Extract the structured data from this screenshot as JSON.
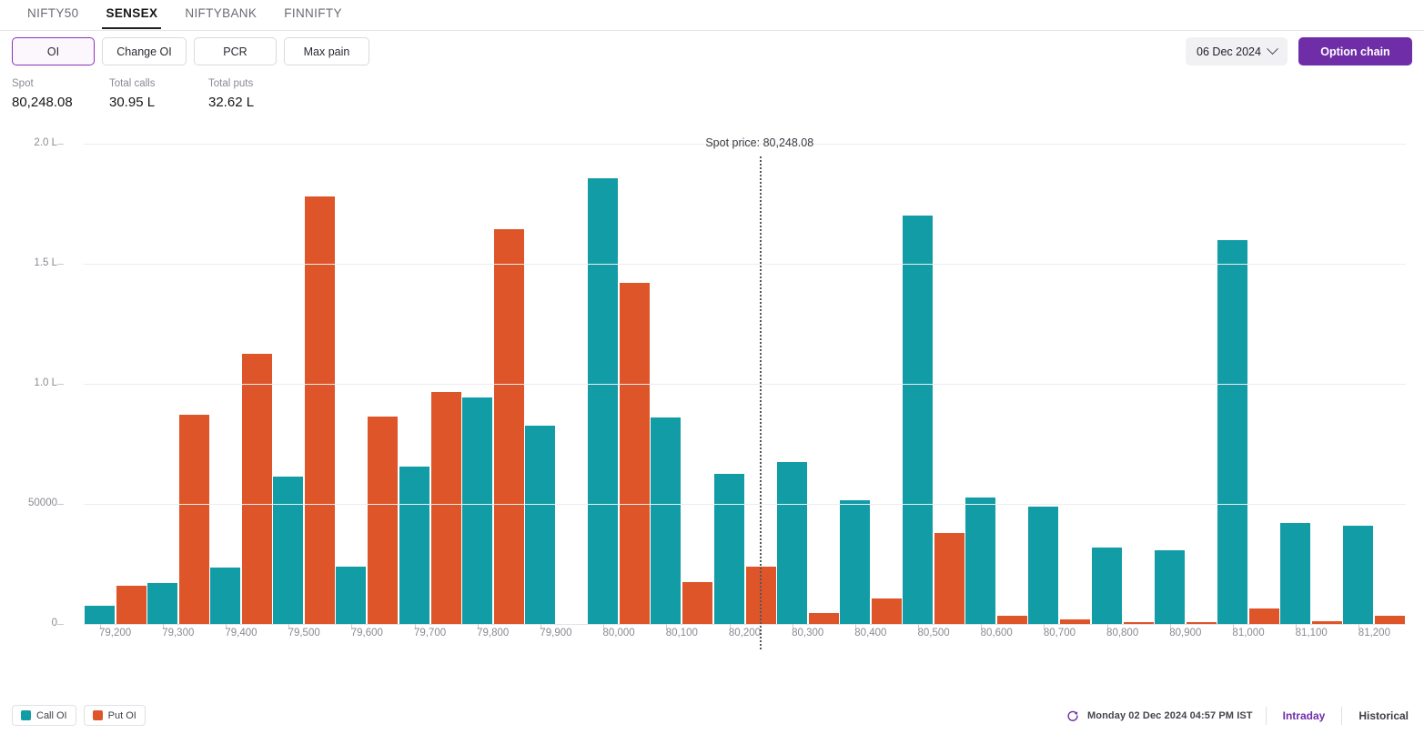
{
  "tabs": [
    {
      "label": "NIFTY50",
      "active": false
    },
    {
      "label": "SENSEX",
      "active": true
    },
    {
      "label": "NIFTYBANK",
      "active": false
    },
    {
      "label": "FINNIFTY",
      "active": false
    }
  ],
  "toolbar": {
    "oi_label": "OI",
    "change_oi_label": "Change OI",
    "pcr_label": "PCR",
    "max_pain_label": "Max pain",
    "expiry_date": "06 Dec 2024",
    "option_chain_label": "Option chain"
  },
  "stats": {
    "spot_label": "Spot",
    "spot_value": "80,248.08",
    "total_calls_label": "Total calls",
    "total_calls_value": "30.95 L",
    "total_puts_label": "Total puts",
    "total_puts_value": "32.62 L"
  },
  "footer": {
    "legend": [
      {
        "label": "Call OI",
        "color": "#119ca6"
      },
      {
        "label": "Put OI",
        "color": "#dd5529"
      }
    ],
    "timestamp": "Monday 02 Dec 2024 04:57 PM IST",
    "intraday_label": "Intraday",
    "historical_label": "Historical"
  },
  "chart_data": {
    "type": "bar",
    "title": "",
    "xlabel": "",
    "ylabel": "",
    "ylim": [
      0,
      200000
    ],
    "grid": true,
    "legend_position": "bottom-left",
    "ytick_values": [
      0,
      50000,
      100000,
      150000,
      200000
    ],
    "ytick_labels": [
      "0",
      "50000",
      "1.0 L",
      "1.5 L",
      "2.0 L"
    ],
    "annotation": {
      "label": "Spot price: 80,248.08",
      "x_value": 80248.08
    },
    "colors": {
      "call": "#119ca6",
      "put": "#dd5529"
    },
    "categories": [
      "79,200",
      "79,300",
      "79,400",
      "79,500",
      "79,600",
      "79,700",
      "79,800",
      "79,900",
      "80,000",
      "80,100",
      "80,200",
      "80,300",
      "80,400",
      "80,500",
      "80,600",
      "80,700",
      "80,800",
      "80,900",
      "81,000",
      "81,100",
      "81,200"
    ],
    "series": [
      {
        "name": "Call OI",
        "values": [
          7500,
          17000,
          23500,
          61500,
          24000,
          65500,
          94500,
          82500,
          185500,
          86000,
          62500,
          67500,
          51500,
          170000,
          52500,
          49000,
          32000,
          30500,
          160000,
          42000,
          41000
        ]
      },
      {
        "name": "Put OI",
        "values": [
          16000,
          87000,
          112500,
          178000,
          86500,
          96500,
          164500,
          0,
          142000,
          17500,
          24000,
          4500,
          10500,
          38000,
          3500,
          2000,
          800,
          700,
          6500,
          1200,
          3500
        ]
      }
    ]
  }
}
